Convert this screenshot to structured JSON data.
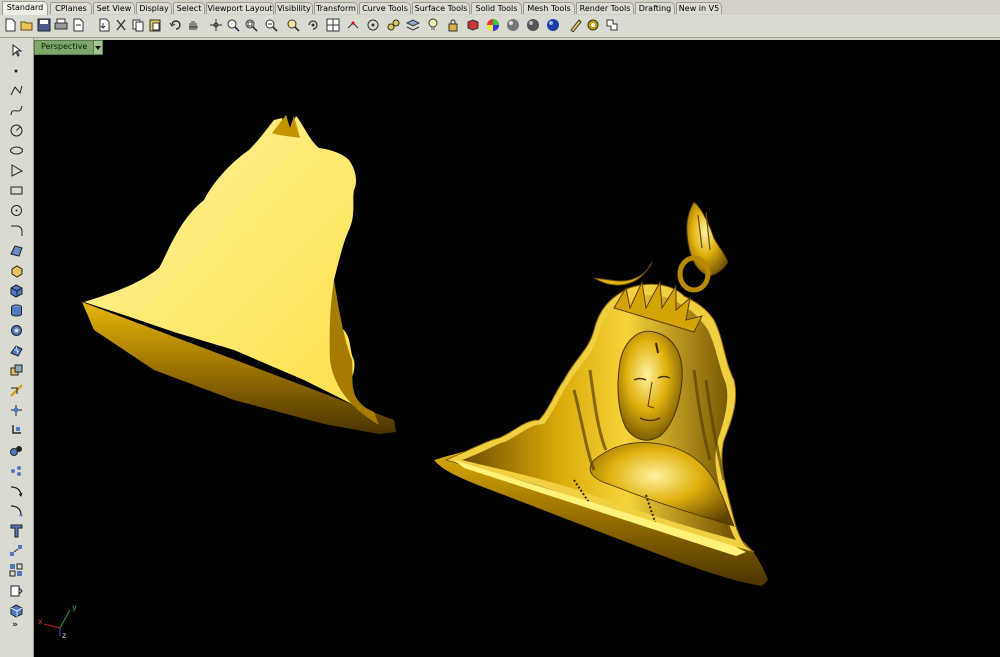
{
  "tabs": [
    {
      "label": "Standard",
      "active": true
    },
    {
      "label": "CPlanes"
    },
    {
      "label": "Set View"
    },
    {
      "label": "Display"
    },
    {
      "label": "Select"
    },
    {
      "label": "Viewport Layout"
    },
    {
      "label": "Visibility"
    },
    {
      "label": "Transform"
    },
    {
      "label": "Curve Tools"
    },
    {
      "label": "Surface Tools"
    },
    {
      "label": "Solid Tools"
    },
    {
      "label": "Mesh Tools"
    },
    {
      "label": "Render Tools"
    },
    {
      "label": "Drafting"
    },
    {
      "label": "New in V5"
    }
  ],
  "toolbar_icons": [
    "new-icon",
    "open-icon",
    "save-icon",
    "print-icon",
    "import-icon",
    "cut-icon",
    "copy-icon",
    "paste-icon",
    "undo-icon",
    "pan-icon",
    "rotate-view-icon",
    "zoom-window-icon",
    "zoom-extents-icon",
    "zoom-selected-icon",
    "zoom-icon",
    "undo-view-icon",
    "four-viewports-icon",
    "grid-snap-icon",
    "osnap-icon",
    "select-all-icon",
    "layer-icon",
    "light-icon",
    "lock-icon",
    "object-properties-icon",
    "color-wheel-icon",
    "render-preview-icon",
    "sphere-render-icon",
    "render-icon",
    "rhino-options-icon",
    "settings-gear-icon",
    "script-icon"
  ],
  "sidebar_icons": [
    "select-arrow-icon",
    "point-icon",
    "polyline-icon",
    "curve-icon",
    "circle-icon",
    "ellipse-icon",
    "polygon-icon",
    "rectangle-icon",
    "arc-icon",
    "fillet-curve-icon",
    "surface-icon",
    "extrude-icon",
    "box-icon",
    "cylinder-icon",
    "pipe-icon",
    "mesh-icon",
    "boolean-icon",
    "transform-icon",
    "move-icon",
    "group-icon",
    "split-icon",
    "join-icon",
    "explode-icon",
    "text-icon",
    "dimension-icon",
    "array-icon",
    "block-icon",
    "viewport-icon"
  ],
  "sidebar_more": "»",
  "viewport": {
    "title": "Perspective",
    "background": "#000000",
    "axis_labels": {
      "x": "x",
      "y": "y",
      "z": "z"
    }
  },
  "colors": {
    "gold_bright": "#ffe766",
    "gold_mid": "#c9a000",
    "gold_dark": "#5c4100",
    "viewport_tab": "#7da868"
  }
}
